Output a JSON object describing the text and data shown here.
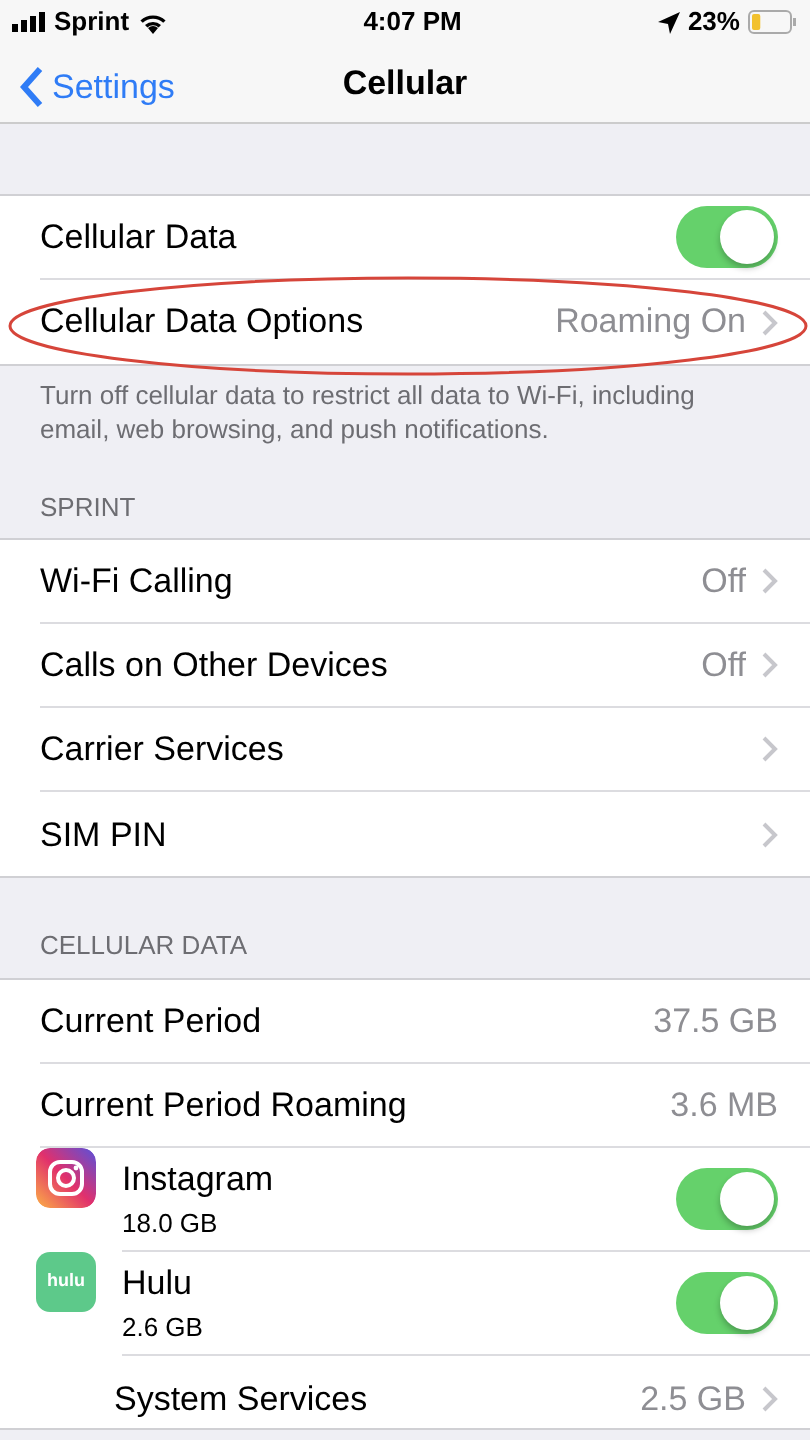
{
  "status_bar": {
    "carrier": "Sprint",
    "time": "4:07 PM",
    "battery": "23%"
  },
  "nav": {
    "back": "Settings",
    "title": "Cellular"
  },
  "sections": [
    {
      "footer": "Turn off cellular data to restrict all data to Wi-Fi, including email, web browsing, and push notifications.",
      "rows": [
        {
          "kind": "toggle",
          "label": "Cellular Data",
          "on": true,
          "circled": false
        },
        {
          "kind": "link",
          "label": "Cellular Data Options",
          "value": "Roaming On",
          "circled": true
        }
      ]
    },
    {
      "header": "SPRINT",
      "rows": [
        {
          "kind": "link",
          "label": "Wi-Fi Calling",
          "value": "Off"
        },
        {
          "kind": "link",
          "label": "Calls on Other Devices",
          "value": "Off"
        },
        {
          "kind": "link",
          "label": "Carrier Services"
        },
        {
          "kind": "link",
          "label": "SIM PIN"
        }
      ]
    },
    {
      "header": "CELLULAR DATA",
      "rows": [
        {
          "kind": "value",
          "label": "Current Period",
          "value": "37.5 GB"
        },
        {
          "kind": "value",
          "label": "Current Period Roaming",
          "value": "3.6 MB"
        },
        {
          "kind": "app",
          "label": "Instagram",
          "detail": "18.0 GB",
          "on": true
        },
        {
          "kind": "app",
          "icon_text": "hulu",
          "label": "Hulu",
          "detail": "2.6 GB",
          "on": true
        },
        {
          "kind": "link",
          "label": "System Services",
          "value": "2.5 GB",
          "indented": true
        }
      ]
    }
  ]
}
